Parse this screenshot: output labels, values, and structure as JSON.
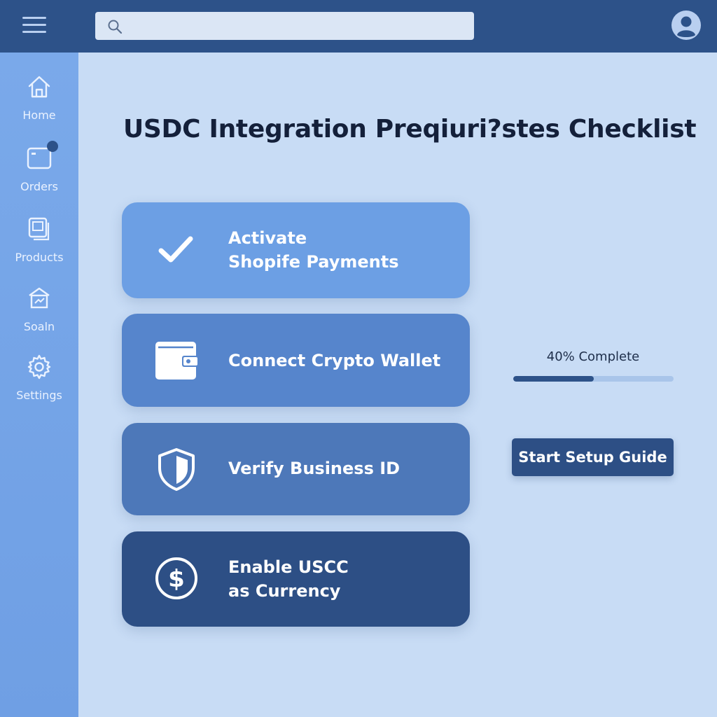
{
  "header": {
    "search": {
      "value": "",
      "placeholder": ""
    }
  },
  "sidebar": {
    "items": [
      {
        "label": "Home",
        "icon": "home-icon"
      },
      {
        "label": "Orders",
        "icon": "orders-icon",
        "badge": true
      },
      {
        "label": "Products",
        "icon": "products-icon"
      },
      {
        "label": "Soaln",
        "icon": "store-icon"
      },
      {
        "label": "Settings",
        "icon": "gear-icon"
      }
    ]
  },
  "main": {
    "title": "USDC Integration Preqiuri?stes Checklist",
    "checklist": [
      {
        "line1": "Activate",
        "line2": "Shopife Payments",
        "icon": "check-icon",
        "status": "completed"
      },
      {
        "line1": "Connect Crypto Wallet",
        "line2": "",
        "icon": "wallet-icon",
        "status": "pending"
      },
      {
        "line1": "Verify Business ID",
        "line2": "",
        "icon": "shield-icon",
        "status": "pending"
      },
      {
        "line1": "Enable USCC",
        "line2": "as Currency",
        "icon": "dollar-icon",
        "status": "pending"
      }
    ],
    "progress": {
      "label": "40% Complete",
      "value": 0.5
    },
    "setup_button": "Start Setup Guide"
  },
  "colors": {
    "topbar": "#2d5289",
    "sidebar": "#7aa9ea",
    "background": "#c8dcf5",
    "card1": "#6c9fe4",
    "card2": "#5685cc",
    "card3": "#4d78b9",
    "card4": "#2d4f85"
  }
}
